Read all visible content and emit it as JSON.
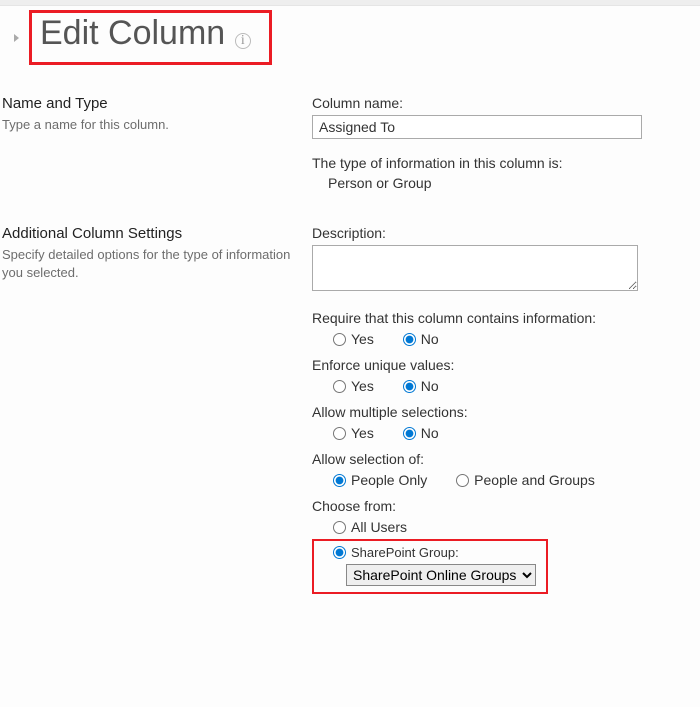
{
  "page": {
    "title": "Edit Column"
  },
  "section1": {
    "header": "Name and Type",
    "sub": "Type a name for this column.",
    "colname_label": "Column name:",
    "colname_value": "Assigned To",
    "type_label": "The type of information in this column is:",
    "type_value": "Person or Group"
  },
  "section2": {
    "header": "Additional Column Settings",
    "sub": "Specify detailed options for the type of information you selected.",
    "desc_label": "Description:",
    "desc_value": "",
    "require_label": "Require that this column contains information:",
    "yes": "Yes",
    "no": "No",
    "unique_label": "Enforce unique values:",
    "multi_label": "Allow multiple selections:",
    "selection_label": "Allow selection of:",
    "people_only": "People Only",
    "people_groups": "People and Groups",
    "choose_label": "Choose from:",
    "all_users": "All Users",
    "sp_group": "SharePoint Group:",
    "sp_group_value": "SharePoint Online Groups"
  }
}
